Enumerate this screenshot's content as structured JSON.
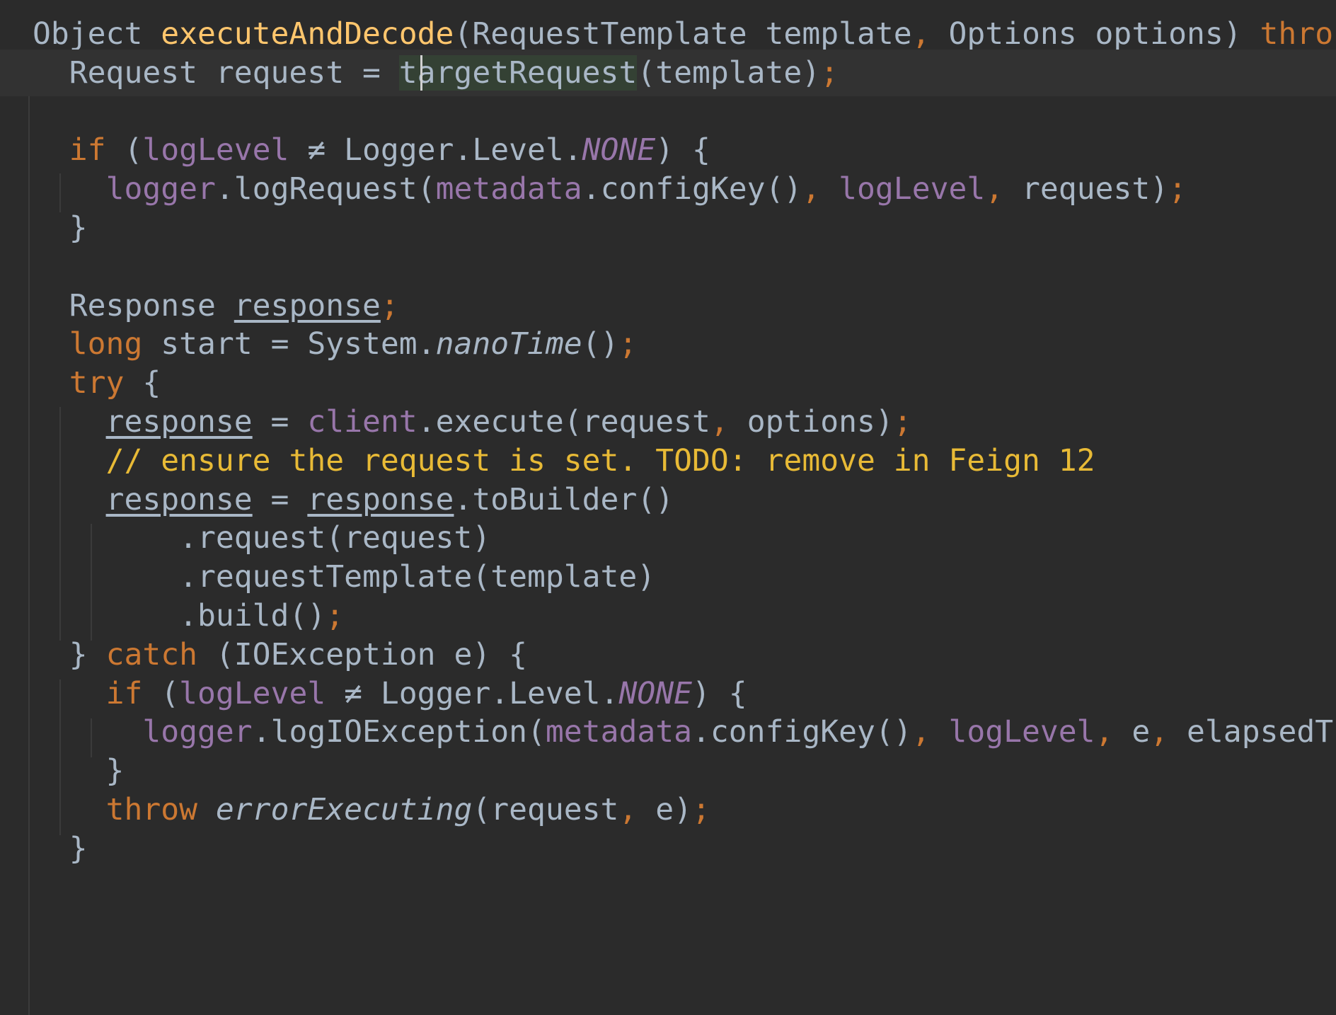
{
  "editor": {
    "language": "java",
    "colors": {
      "background": "#2b2b2b",
      "current_line": "#323232",
      "default_text": "#a9b7c6",
      "keyword": "#cc7832",
      "method_declaration": "#ffc66d",
      "field": "#9876aa",
      "todo_comment": "#e8ba36",
      "identifier_highlight": "#344134"
    },
    "lines": [
      [
        {
          "t": "Object ",
          "s": ""
        },
        {
          "t": "executeAndDecode",
          "s": "fn"
        },
        {
          "t": "(RequestTemplate template",
          "s": ""
        },
        {
          "t": ", ",
          "s": "kw"
        },
        {
          "t": "Options options) ",
          "s": ""
        },
        {
          "t": "thro",
          "s": "kw"
        }
      ],
      [
        {
          "t": "  Request request = ",
          "s": ""
        },
        {
          "t": "targetRequest",
          "s": "hl"
        },
        {
          "t": "(template)",
          "s": ""
        },
        {
          "t": ";",
          "s": "kw"
        }
      ],
      [],
      [
        {
          "t": "  ",
          "s": ""
        },
        {
          "t": "if ",
          "s": "kw"
        },
        {
          "t": "(",
          "s": ""
        },
        {
          "t": "logLevel",
          "s": "fld"
        },
        {
          "t": " ≠ Logger.Level.",
          "s": ""
        },
        {
          "t": "NONE",
          "s": "fld-it"
        },
        {
          "t": ") {",
          "s": ""
        }
      ],
      [
        {
          "t": "    ",
          "s": ""
        },
        {
          "t": "logger",
          "s": "fld"
        },
        {
          "t": ".logRequest(",
          "s": ""
        },
        {
          "t": "metadata",
          "s": "fld"
        },
        {
          "t": ".configKey()",
          "s": ""
        },
        {
          "t": ", ",
          "s": "kw"
        },
        {
          "t": "logLevel",
          "s": "fld"
        },
        {
          "t": ", ",
          "s": "kw"
        },
        {
          "t": "request)",
          "s": ""
        },
        {
          "t": ";",
          "s": "kw"
        }
      ],
      [
        {
          "t": "  }",
          "s": ""
        }
      ],
      [],
      [
        {
          "t": "  Response ",
          "s": ""
        },
        {
          "t": "response",
          "s": "ul"
        },
        {
          "t": ";",
          "s": "kw"
        }
      ],
      [
        {
          "t": "  ",
          "s": ""
        },
        {
          "t": "long ",
          "s": "kw"
        },
        {
          "t": "start = System.",
          "s": ""
        },
        {
          "t": "nanoTime",
          "s": "it"
        },
        {
          "t": "()",
          "s": ""
        },
        {
          "t": ";",
          "s": "kw"
        }
      ],
      [
        {
          "t": "  ",
          "s": ""
        },
        {
          "t": "try ",
          "s": "kw"
        },
        {
          "t": "{",
          "s": ""
        }
      ],
      [
        {
          "t": "    ",
          "s": ""
        },
        {
          "t": "response",
          "s": "ul"
        },
        {
          "t": " = ",
          "s": ""
        },
        {
          "t": "client",
          "s": "fld"
        },
        {
          "t": ".execute(request",
          "s": ""
        },
        {
          "t": ", ",
          "s": "kw"
        },
        {
          "t": "options)",
          "s": ""
        },
        {
          "t": ";",
          "s": "kw"
        }
      ],
      [
        {
          "t": "    ",
          "s": ""
        },
        {
          "t": "// ensure the request is set. TODO: remove in Feign 12",
          "s": "cmt"
        }
      ],
      [
        {
          "t": "    ",
          "s": ""
        },
        {
          "t": "response",
          "s": "ul"
        },
        {
          "t": " = ",
          "s": ""
        },
        {
          "t": "response",
          "s": "ul"
        },
        {
          "t": ".toBuilder()",
          "s": ""
        }
      ],
      [
        {
          "t": "        .request(request)",
          "s": ""
        }
      ],
      [
        {
          "t": "        .requestTemplate(template)",
          "s": ""
        }
      ],
      [
        {
          "t": "        .build()",
          "s": ""
        },
        {
          "t": ";",
          "s": "kw"
        }
      ],
      [
        {
          "t": "  } ",
          "s": ""
        },
        {
          "t": "catch ",
          "s": "kw"
        },
        {
          "t": "(IOException e) {",
          "s": ""
        }
      ],
      [
        {
          "t": "    ",
          "s": ""
        },
        {
          "t": "if ",
          "s": "kw"
        },
        {
          "t": "(",
          "s": ""
        },
        {
          "t": "logLevel",
          "s": "fld"
        },
        {
          "t": " ≠ Logger.Level.",
          "s": ""
        },
        {
          "t": "NONE",
          "s": "fld-it"
        },
        {
          "t": ") {",
          "s": ""
        }
      ],
      [
        {
          "t": "      ",
          "s": ""
        },
        {
          "t": "logger",
          "s": "fld"
        },
        {
          "t": ".logIOException(",
          "s": ""
        },
        {
          "t": "metadata",
          "s": "fld"
        },
        {
          "t": ".configKey()",
          "s": ""
        },
        {
          "t": ", ",
          "s": "kw"
        },
        {
          "t": "logLevel",
          "s": "fld"
        },
        {
          "t": ", ",
          "s": "kw"
        },
        {
          "t": "e",
          "s": ""
        },
        {
          "t": ", ",
          "s": "kw"
        },
        {
          "t": "elapsedT",
          "s": ""
        }
      ],
      [
        {
          "t": "    }",
          "s": ""
        }
      ],
      [
        {
          "t": "    ",
          "s": ""
        },
        {
          "t": "throw ",
          "s": "kw"
        },
        {
          "t": "errorExecuting",
          "s": "it"
        },
        {
          "t": "(request",
          "s": ""
        },
        {
          "t": ", ",
          "s": "kw"
        },
        {
          "t": "e)",
          "s": ""
        },
        {
          "t": ";",
          "s": "kw"
        }
      ],
      [
        {
          "t": "  }",
          "s": ""
        }
      ]
    ]
  }
}
